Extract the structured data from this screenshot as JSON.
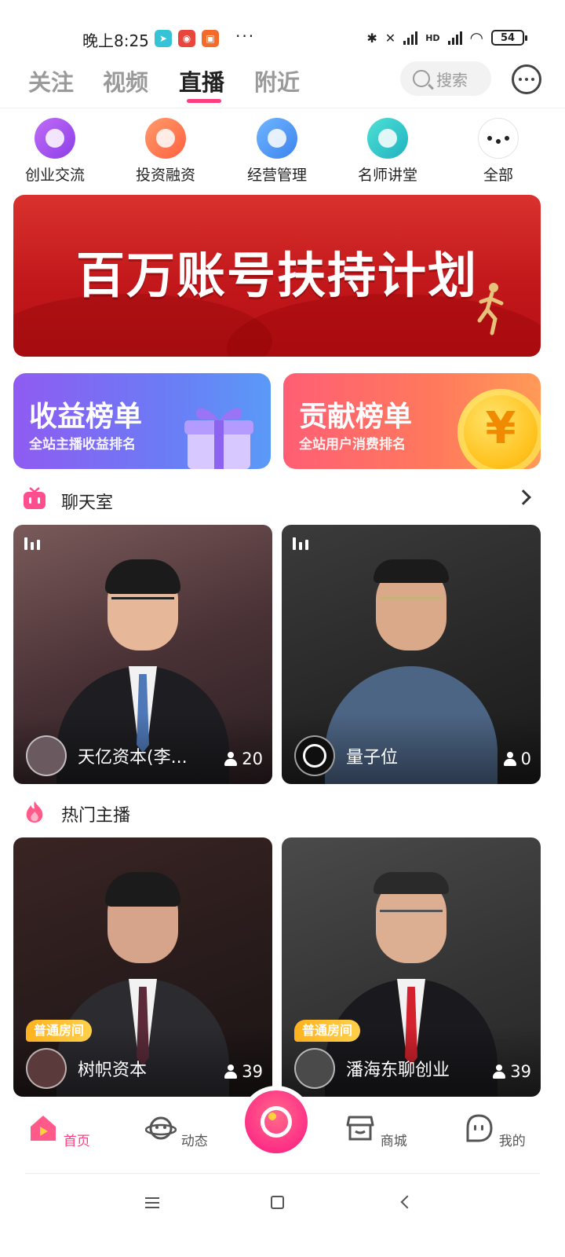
{
  "status_bar": {
    "time": "晚上8:25",
    "more": "···",
    "network_label": "HD",
    "battery": "54"
  },
  "top_nav": {
    "tabs": [
      {
        "label": "关注",
        "active": false
      },
      {
        "label": "视频",
        "active": false
      },
      {
        "label": "直播",
        "active": true
      },
      {
        "label": "附近",
        "active": false
      }
    ],
    "search_placeholder": "搜索"
  },
  "categories": [
    {
      "label": "创业交流",
      "color": "#a056ee"
    },
    {
      "label": "投资融资",
      "color": "#ff7a55"
    },
    {
      "label": "经营管理",
      "color": "#4a9cf5"
    },
    {
      "label": "名师讲堂",
      "color": "#26c6c2"
    },
    {
      "label": "全部",
      "color": "#ffffff"
    }
  ],
  "banner": {
    "title": "百万账号扶持计划"
  },
  "rankings": [
    {
      "title": "收益榜单",
      "subtitle": "全站主播收益排名"
    },
    {
      "title": "贡献榜单",
      "subtitle": "全站用户消费排名",
      "coin_symbol": "¥"
    }
  ],
  "chat_room": {
    "title": "聊天室",
    "cards": [
      {
        "name": "天亿资本(李...",
        "viewers": "20"
      },
      {
        "name": "量子位",
        "viewers": "0"
      }
    ]
  },
  "hot_hosts": {
    "title": "热门主播",
    "cards": [
      {
        "badge": "普通房间",
        "name": "树帜资本",
        "viewers": "39"
      },
      {
        "badge": "普通房间",
        "name": "潘海东聊创业",
        "viewers": "39"
      }
    ]
  },
  "bottom_nav": {
    "items": [
      {
        "label": "首页",
        "active": true
      },
      {
        "label": "动态",
        "active": false
      },
      {
        "label": "商城",
        "active": false
      },
      {
        "label": "我的",
        "active": false
      }
    ]
  },
  "colors": {
    "accent": "#ff3d7f",
    "banner_red": "#c2171b"
  }
}
